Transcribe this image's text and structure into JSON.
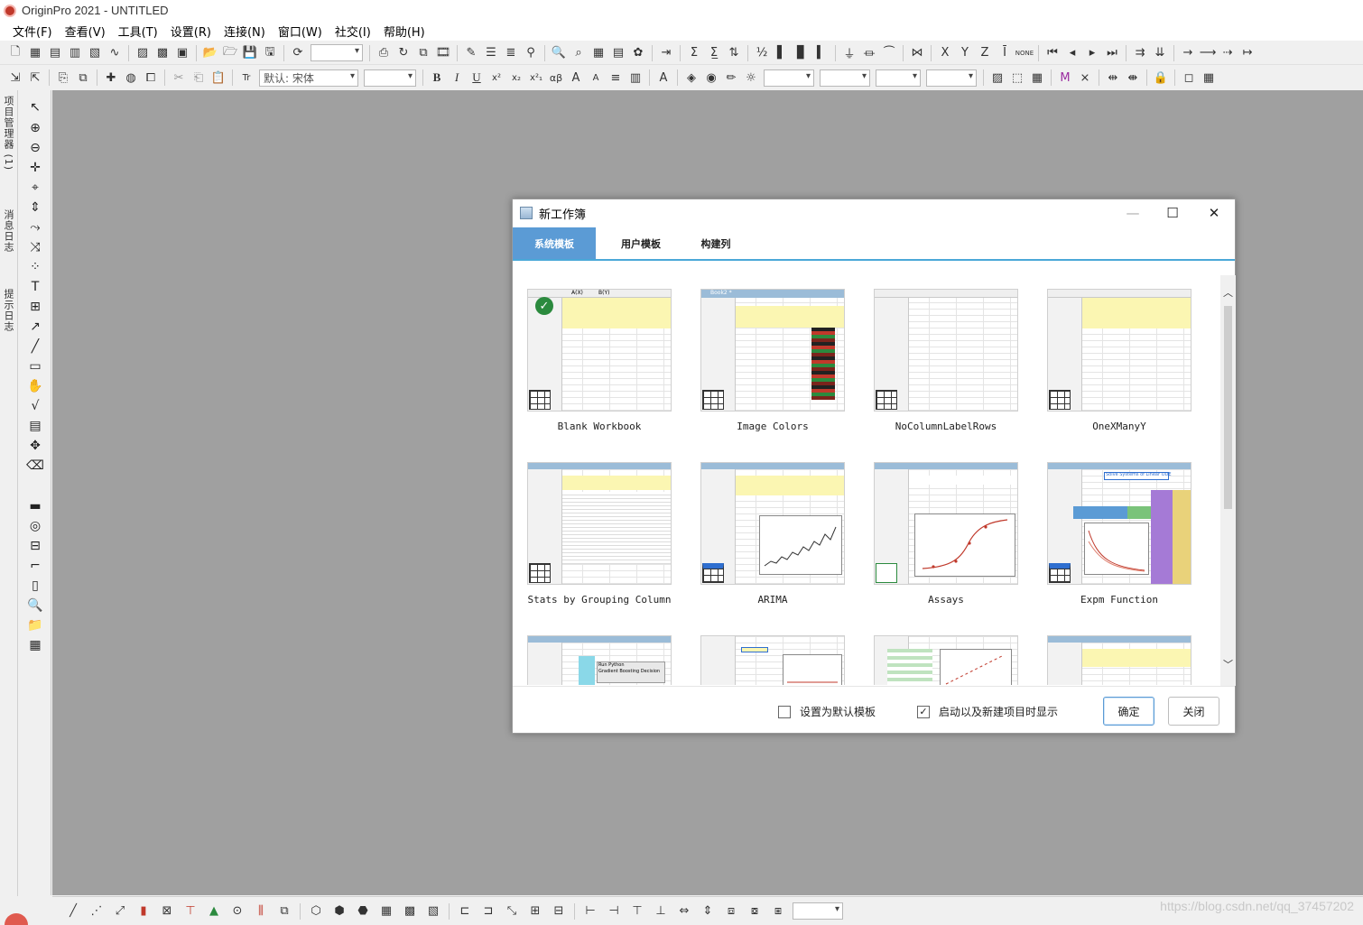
{
  "app": {
    "title": "OriginPro 2021 - UNTITLED"
  },
  "menubar": {
    "items": [
      "文件(F)",
      "查看(V)",
      "工具(T)",
      "设置(R)",
      "连接(N)",
      "窗口(W)",
      "社交(I)",
      "帮助(H)"
    ]
  },
  "toolbar": {
    "font_combo": "默认: 宋体",
    "bold": "B",
    "italic": "I",
    "underline": "U"
  },
  "side_panel": {
    "tabs": [
      "项目管理器 (1)",
      "消息日志",
      "提示日志"
    ]
  },
  "dialog": {
    "title": "新工作簿",
    "tabs": [
      {
        "label": "系统模板",
        "active": true
      },
      {
        "label": "用户模板",
        "active": false
      },
      {
        "label": "构建列",
        "active": false
      }
    ],
    "templates": [
      {
        "label": "Blank Workbook",
        "selected": true
      },
      {
        "label": "Image Colors",
        "selected": false
      },
      {
        "label": "NoColumnLabelRows",
        "selected": false
      },
      {
        "label": "OneXManyY",
        "selected": false
      },
      {
        "label": "Stats by Grouping Column",
        "selected": false
      },
      {
        "label": "ARIMA",
        "selected": false
      },
      {
        "label": "Assays",
        "selected": false
      },
      {
        "label": "Expm Function",
        "selected": false
      },
      {
        "label": "",
        "selected": false
      },
      {
        "label": "",
        "selected": false
      },
      {
        "label": "",
        "selected": false
      },
      {
        "label": "",
        "selected": false
      }
    ],
    "thumb_text": {
      "blank_header": "A(X)",
      "blank_header2": "B(Y)",
      "rows": [
        "Long Name",
        "Units",
        "Comments",
        "F(x)="
      ],
      "image_colors_title": "Book2 *",
      "expm_title": "Solve Systems of Linear ODE",
      "python_lines": [
        "Run Python",
        "Gradient Boosting Decision"
      ]
    },
    "footer": {
      "set_default_label": "设置为默认模板",
      "set_default_checked": false,
      "show_on_start_label": "启动以及新建项目时显示",
      "show_on_start_checked": true,
      "ok_label": "确定",
      "close_label": "关闭"
    }
  },
  "watermark": "https://blog.csdn.net/qq_37457202",
  "colors": {
    "tab_active": "#5b9bd5",
    "tab_underline": "#4aa8d8",
    "workspace": "#a0a0a0"
  }
}
